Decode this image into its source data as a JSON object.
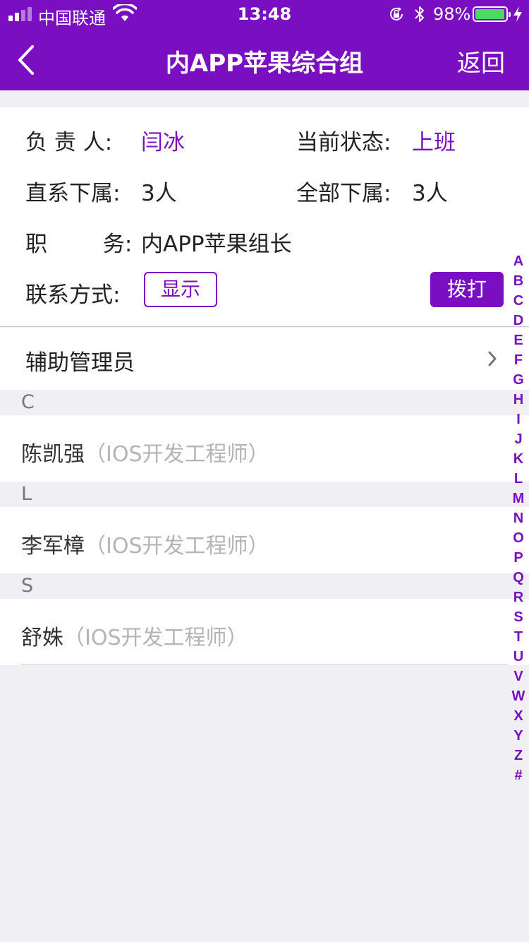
{
  "status_bar": {
    "carrier": "中国联通",
    "time": "13:48",
    "battery_percent": "98%",
    "battery_level": 0.98
  },
  "nav": {
    "title": "内APP苹果综合组",
    "return_label": "返回"
  },
  "info": {
    "leader_label": "负  责  人:",
    "leader_value": "闫冰",
    "status_label": "当前状态:",
    "status_value": "上班",
    "direct_label": "直系下属:",
    "direct_value": "3人",
    "all_label": "全部下属:",
    "all_value": "3人",
    "position_label": "职        务:",
    "position_value": "内APP苹果组长",
    "contact_label": "联系方式:",
    "show_button": "显示",
    "call_button": "拨打"
  },
  "admin": {
    "label": "辅助管理员"
  },
  "sections": [
    {
      "letter": "C",
      "name": "陈凯强",
      "role": "（IOS开发工程师）"
    },
    {
      "letter": "L",
      "name": "李军樟",
      "role": "（IOS开发工程师）"
    },
    {
      "letter": "S",
      "name": "舒姝",
      "role": "（IOS开发工程师）"
    }
  ],
  "index_letters": [
    "A",
    "B",
    "C",
    "D",
    "E",
    "F",
    "G",
    "H",
    "I",
    "J",
    "K",
    "L",
    "M",
    "N",
    "O",
    "P",
    "Q",
    "R",
    "S",
    "T",
    "U",
    "V",
    "W",
    "X",
    "Y",
    "Z",
    "#"
  ],
  "colors": {
    "accent": "#7a0fc2",
    "battery": "#4cd964",
    "background": "#efeff4"
  }
}
